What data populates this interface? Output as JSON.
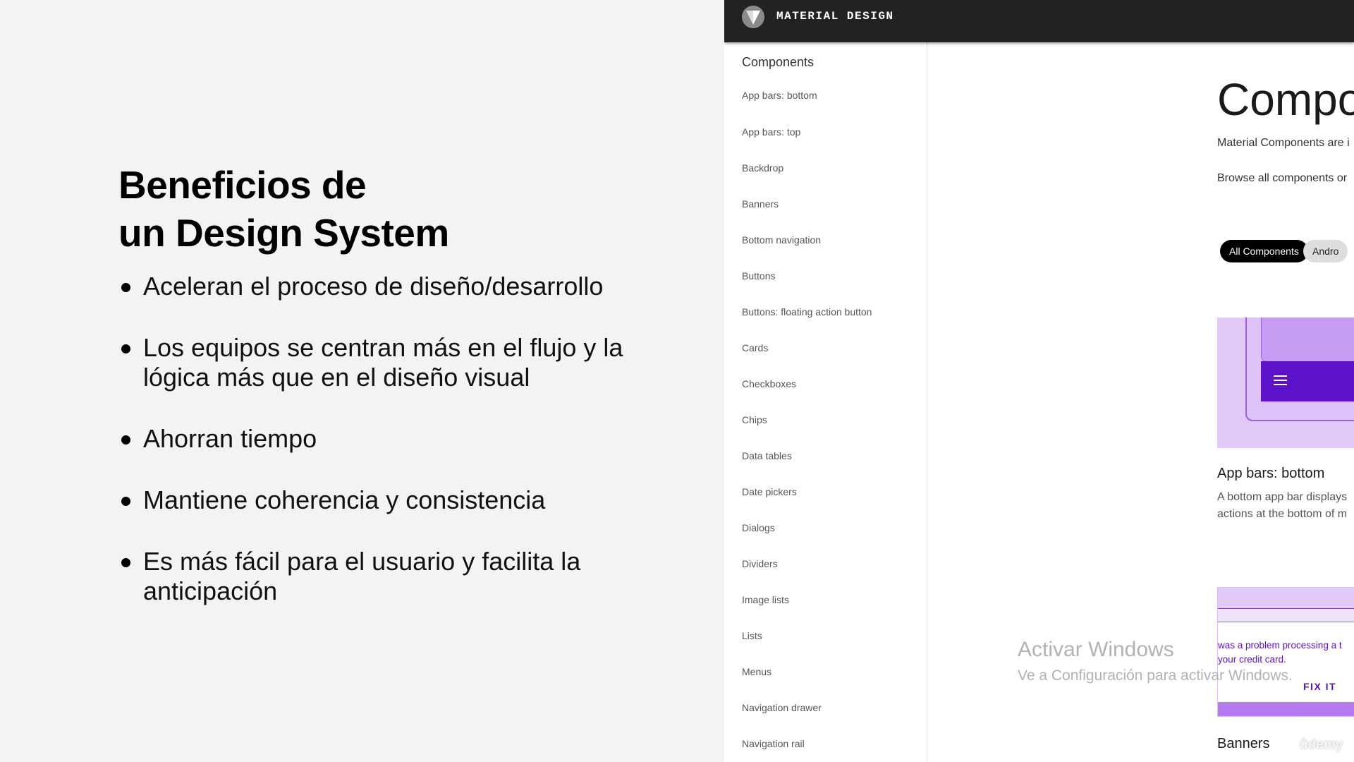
{
  "slide": {
    "title_line1": "Beneficios de",
    "title_line2": "un Design System",
    "bullets": [
      "Aceleran el proceso de diseño/desarrollo",
      "Los equipos se centran más en el flujo y la",
      "lógica más que en el diseño visual",
      "Ahorran tiempo",
      "Mantiene coherencia y consistencia",
      "Es más fácil para el usuario y facilita la",
      "anticipación"
    ]
  },
  "site": {
    "brand": "MATERIAL DESIGN",
    "sidebar": {
      "heading": "Components",
      "items": [
        "App bars: bottom",
        "App bars: top",
        "Backdrop",
        "Banners",
        "Bottom navigation",
        "Buttons",
        "Buttons: floating action button",
        "Cards",
        "Checkboxes",
        "Chips",
        "Data tables",
        "Date pickers",
        "Dialogs",
        "Dividers",
        "Image lists",
        "Lists",
        "Menus",
        "Navigation drawer",
        "Navigation rail"
      ]
    },
    "main": {
      "title": "Compo",
      "intro1": "Material Components are i",
      "intro2": "Browse all components or",
      "chips": [
        "All Components",
        "Andro"
      ],
      "card1": {
        "title": "App bars: bottom",
        "desc_line1": "A bottom app bar displays",
        "desc_line2": "actions at the bottom of m"
      },
      "card2": {
        "msg_line1": "was a problem processing a t",
        "msg_line2": "your credit card.",
        "action": "FIX IT",
        "title": "Banners"
      }
    }
  },
  "overlay": {
    "activate_title": "Activar Windows",
    "activate_sub": "Ve a Configuración para activar Windows.",
    "udemy": "ûdemy"
  },
  "colors": {
    "topbar": "#222222",
    "purple_dark": "#5b12c8",
    "purple_light": "#e1c9f8"
  }
}
